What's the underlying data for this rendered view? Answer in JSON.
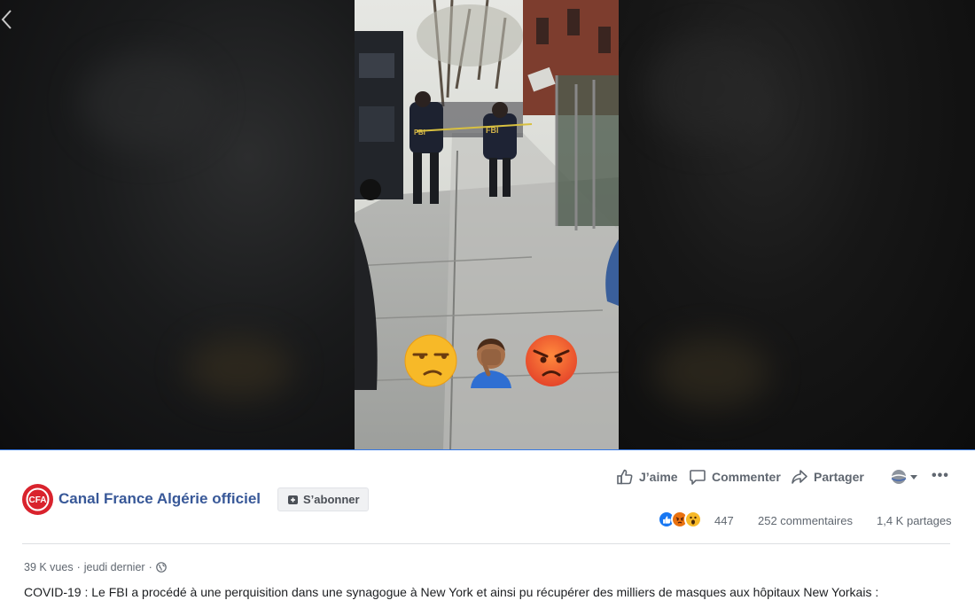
{
  "video": {
    "overlay_emojis": [
      "unamused-face",
      "person-facepalming",
      "angry-face"
    ]
  },
  "post": {
    "page_name": "Canal France Algérie officiel",
    "subscribe_label": "S’abonner",
    "actions": {
      "like_label": "J’aime",
      "comment_label": "Commenter",
      "share_label": "Partager"
    },
    "stats": {
      "reaction_icons": [
        "like",
        "angry",
        "wow"
      ],
      "reaction_count": "447",
      "comments": "252 commentaires",
      "shares": "1,4 K partages"
    },
    "meta": {
      "views": "39 K vues",
      "separator": "·",
      "time": "jeudi dernier",
      "privacy_icon": "globe-icon"
    },
    "caption": "COVID-19 : Le FBI a procédé à une perquisition dans une synagogue à New York et ainsi pu récupérer des milliers de masques aux hôpitaux New Yorkais :"
  },
  "colors": {
    "page_name": "#385898",
    "progress": "#3578e5",
    "like_blue": "#1877f2",
    "angry_red": "#e9710f"
  }
}
